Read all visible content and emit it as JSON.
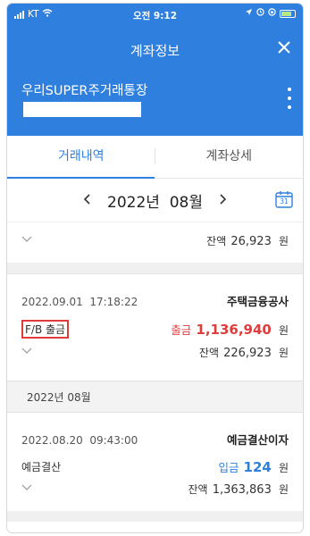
{
  "status_bar": {
    "carrier": "KT",
    "time": "오전 9:12"
  },
  "header": {
    "title": "계좌정보",
    "account_name": "우리SUPER주거래통장"
  },
  "tabs": [
    {
      "label": "거래내역",
      "active": true
    },
    {
      "label": "계좌상세",
      "active": false
    }
  ],
  "month_selector": {
    "label": "2022년  08월",
    "calendar_day": "31"
  },
  "transactions": {
    "first_partial": {
      "balance_label": "잔액",
      "balance": "26,923",
      "unit": "원"
    },
    "item1": {
      "datetime": "2022.09.01  17:18:22",
      "counterparty": "주택금융공사",
      "memo": "F/B 출금",
      "type_label": "출금",
      "amount": "1,136,940",
      "unit": "원",
      "balance_label": "잔액",
      "balance": "226,923"
    },
    "section_header": "2022년 08월",
    "item2": {
      "datetime": "2022.08.20  09:43:00",
      "counterparty": "예금결산이자",
      "memo": "예금결산",
      "type_label": "입금",
      "amount": "124",
      "unit": "원",
      "balance_label": "잔액",
      "balance": "1,363,863"
    }
  },
  "colors": {
    "accent": "#2f80de",
    "withdrawal": "#e03c3c",
    "deposit": "#2f80de"
  }
}
